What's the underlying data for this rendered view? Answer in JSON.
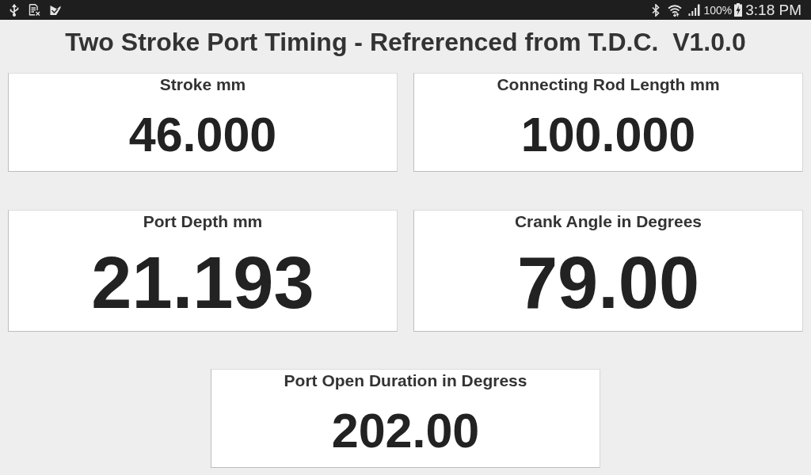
{
  "status_bar": {
    "battery": "100%",
    "clock": "3:18 PM"
  },
  "title": "Two Stroke Port Timing - Refrerenced from T.D.C.  V1.0.0",
  "rows": [
    {
      "panels": [
        {
          "kind": "standard",
          "label": "Stroke mm",
          "value": "46.000"
        },
        {
          "kind": "standard",
          "label": "Connecting Rod Length mm",
          "value": "100.000"
        }
      ]
    },
    {
      "panels": [
        {
          "kind": "large",
          "label": "Port Depth mm",
          "value": "21.193"
        },
        {
          "kind": "large",
          "label": "Crank Angle in Degrees",
          "value": "79.00"
        }
      ]
    },
    {
      "panels": [
        {
          "kind": "standard",
          "label": "Port Open Duration in Degress",
          "value": "202.00"
        }
      ]
    }
  ]
}
